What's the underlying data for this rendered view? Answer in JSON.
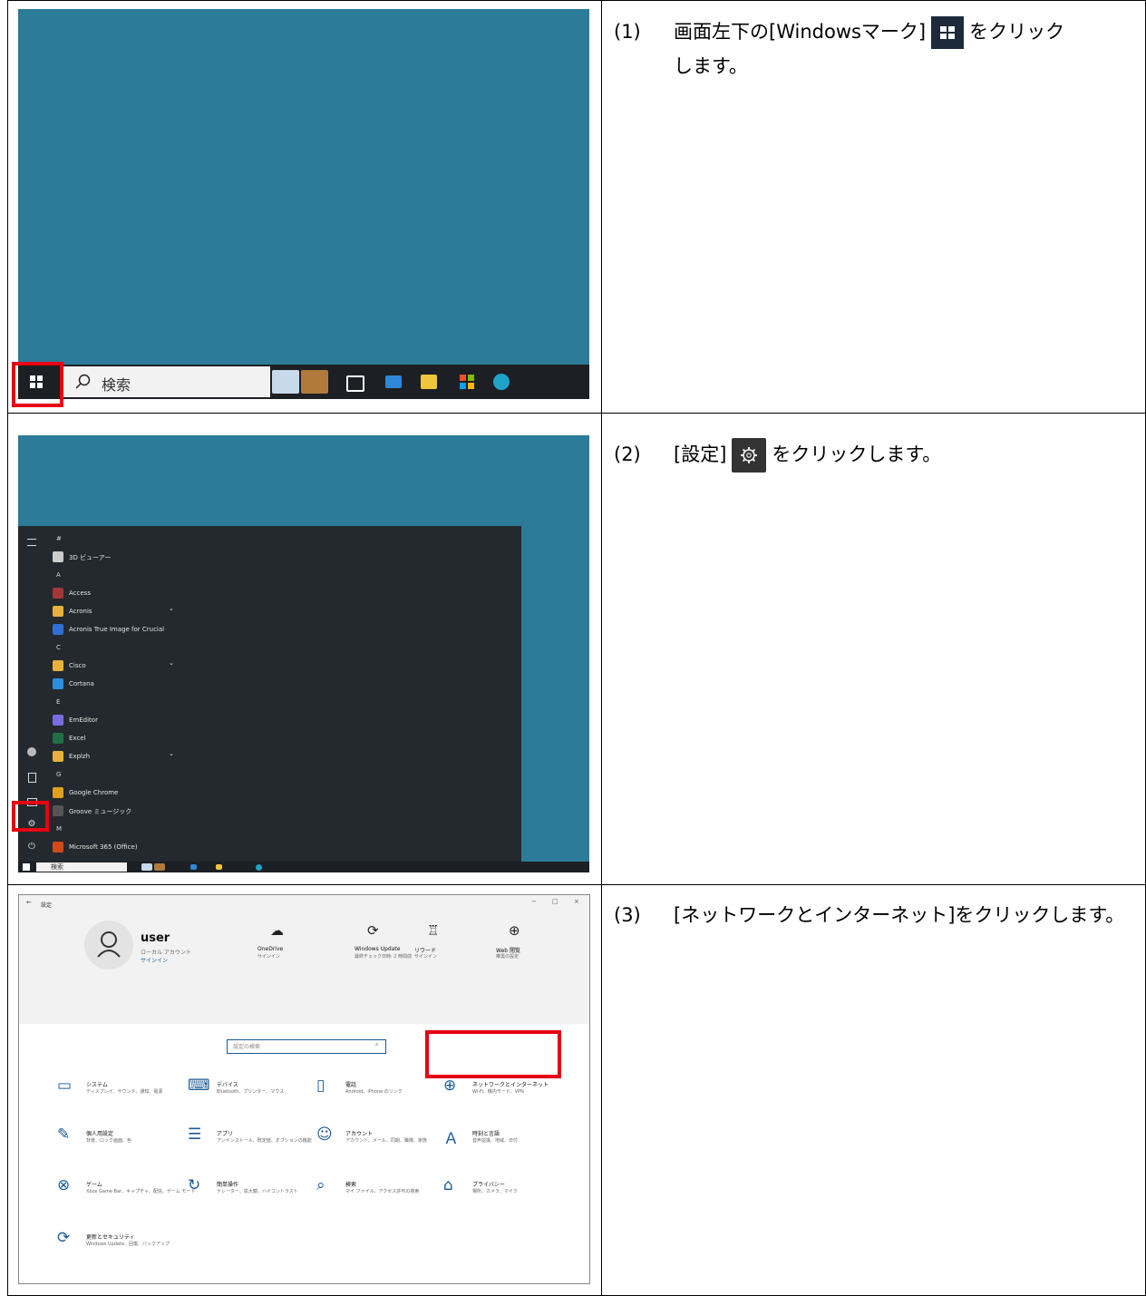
{
  "steps": [
    {
      "number": "(1)",
      "text_before": "画面左下の[Windowsマーク]",
      "text_after": "をクリック",
      "text_line2": "します。",
      "inline_icon": "windows-logo-icon"
    },
    {
      "number": "(2)",
      "text_before": "[設定]",
      "text_after": "をクリックします。",
      "inline_icon": "gear-icon"
    },
    {
      "number": "(3)",
      "text": "[ネットワークとインターネット]をクリックします。"
    }
  ],
  "taskbar": {
    "search_label": "検索"
  },
  "start_menu": {
    "entries": [
      {
        "kind": "letter",
        "text": "#"
      },
      {
        "kind": "item",
        "text": "3D ビューアー",
        "icon": "cube-icon",
        "color": "#cccccc"
      },
      {
        "kind": "letter",
        "text": "A"
      },
      {
        "kind": "item",
        "text": "Access",
        "icon": "access-icon",
        "color": "#a4373a"
      },
      {
        "kind": "item",
        "text": "Acronis",
        "icon": "folder-icon",
        "color": "#e8b23a",
        "expand": true
      },
      {
        "kind": "item",
        "text": "Acronis True Image for Crucial",
        "icon": "acronis-icon",
        "color": "#2f6fd0"
      },
      {
        "kind": "letter",
        "text": "C"
      },
      {
        "kind": "item",
        "text": "Cisco",
        "icon": "folder-icon",
        "color": "#e8b23a",
        "expand": true
      },
      {
        "kind": "item",
        "text": "Cortana",
        "icon": "cortana-icon",
        "color": "#2d8ee0"
      },
      {
        "kind": "letter",
        "text": "E"
      },
      {
        "kind": "item",
        "text": "EmEditor",
        "icon": "emeditor-icon",
        "color": "#7a6ce0"
      },
      {
        "kind": "item",
        "text": "Excel",
        "icon": "excel-icon",
        "color": "#1e7145"
      },
      {
        "kind": "item",
        "text": "Explzh",
        "icon": "folder-icon",
        "color": "#e8b23a",
        "expand": true
      },
      {
        "kind": "letter",
        "text": "G"
      },
      {
        "kind": "item",
        "text": "Google Chrome",
        "icon": "chrome-icon",
        "color": "#e0a020"
      },
      {
        "kind": "item",
        "text": "Groove ミュージック",
        "icon": "groove-icon",
        "color": "#555555"
      },
      {
        "kind": "letter",
        "text": "M"
      },
      {
        "kind": "item",
        "text": "Microsoft 365 (Office)",
        "icon": "office-icon",
        "color": "#d04a1a"
      }
    ],
    "search_label": "検索"
  },
  "settings": {
    "title": "設定",
    "user_name": "user",
    "account_type": "ローカル アカウント",
    "sign_in": "サインイン",
    "top_tiles": [
      {
        "icon": "onedrive-icon",
        "title": "OneDrive",
        "sub": "サインイン"
      },
      {
        "icon": "windows-update-icon",
        "title": "Windows Update",
        "sub": "最終チェック日時: 2 時間前"
      },
      {
        "icon": "rewards-icon",
        "title": "リワード",
        "sub": "サインイン"
      },
      {
        "icon": "web-icon",
        "title": "Web 閲覧",
        "sub": "推奨の設定"
      }
    ],
    "search_placeholder": "設定の検索",
    "categories": [
      {
        "icon": "system-icon",
        "title": "システム",
        "sub": "ディスプレイ、サウンド、通知、電源"
      },
      {
        "icon": "devices-icon",
        "title": "デバイス",
        "sub": "Bluetooth、プリンター、マウス"
      },
      {
        "icon": "phone-icon",
        "title": "電話",
        "sub": "Android、iPhone のリンク"
      },
      {
        "icon": "network-icon",
        "title": "ネットワークとインターネット",
        "sub": "Wi-Fi、機内モード、VPN"
      },
      {
        "icon": "personalization-icon",
        "title": "個人用設定",
        "sub": "背景、ロック画面、色"
      },
      {
        "icon": "apps-icon",
        "title": "アプリ",
        "sub": "アンインストール、既定値、オプションの機能"
      },
      {
        "icon": "accounts-icon",
        "title": "アカウント",
        "sub": "アカウント、メール、同期、職場、家族"
      },
      {
        "icon": "time-language-icon",
        "title": "時刻と言語",
        "sub": "音声認識、地域、日付"
      },
      {
        "icon": "gaming-icon",
        "title": "ゲーム",
        "sub": "Xbox Game Bar、キャプチャ、配信、ゲーム モード"
      },
      {
        "icon": "ease-of-access-icon",
        "title": "簡単操作",
        "sub": "ナレーター、拡大鏡、ハイコントラスト"
      },
      {
        "icon": "search-icon",
        "title": "検索",
        "sub": "マイ ファイル、アクセス許可の検索"
      },
      {
        "icon": "privacy-icon",
        "title": "プライバシー",
        "sub": "場所、カメラ、マイク"
      },
      {
        "icon": "update-security-icon",
        "title": "更新とセキュリティ",
        "sub": "Windows Update、回復、バックアップ"
      }
    ]
  },
  "colors": {
    "desktop": "#2b7b99",
    "taskbar": "#1c1f24",
    "highlight": "#e60012",
    "settings_accent": "#1a5a96"
  }
}
